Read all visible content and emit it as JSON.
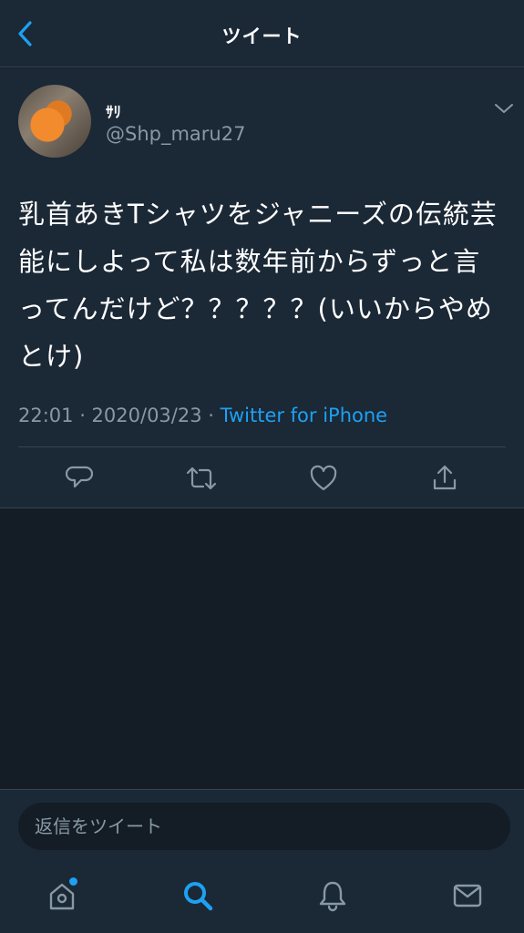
{
  "header": {
    "title": "ツイート",
    "back_icon": "chevron-left-icon"
  },
  "tweet": {
    "user": {
      "name": "ｻﾘ",
      "handle": "@Shp_maru27"
    },
    "text": "乳首あきTシャツをジャニーズの伝統芸能にしよって私は数年前からずっと言ってんだけど？？？？？(いいからやめとけ)",
    "timestamp": "22:01 · 2020/03/23 · ",
    "source": "Twitter for iPhone",
    "actions": [
      "reply-icon",
      "retweet-icon",
      "like-icon",
      "share-icon"
    ]
  },
  "reply": {
    "placeholder": "返信をツイート"
  },
  "bottom_nav": [
    "home-icon",
    "search-icon",
    "notifications-icon",
    "messages-icon"
  ],
  "colors": {
    "accent": "#1da1f2",
    "background": "#141d26",
    "card": "#1b2836",
    "muted": "#8899a6",
    "divider": "#38444d"
  }
}
